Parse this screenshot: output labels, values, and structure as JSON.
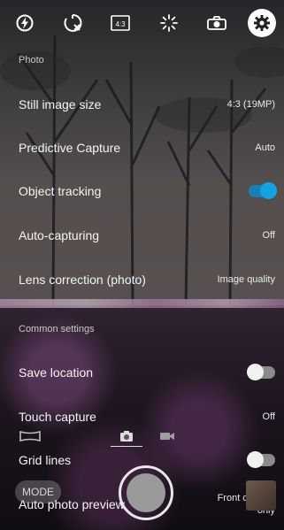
{
  "top_bar": {
    "icons": [
      "flash-auto-icon",
      "timer-off-icon",
      "aspect-ratio-icon",
      "brightness-icon",
      "self-timer-icon",
      "settings-gear-icon"
    ],
    "aspect_label": "4:3"
  },
  "settings": {
    "photo_section": "Photo",
    "still_image_size": {
      "label": "Still image size",
      "value": "4:3 (19MP)"
    },
    "predictive_capture": {
      "label": "Predictive Capture",
      "value": "Auto"
    },
    "object_tracking": {
      "label": "Object tracking",
      "on": true
    },
    "auto_capturing": {
      "label": "Auto-capturing",
      "value": "Off"
    },
    "lens_correction": {
      "label": "Lens correction (photo)",
      "value": "Image quality"
    },
    "common_section": "Common settings",
    "save_location": {
      "label": "Save location",
      "on": false
    },
    "touch_capture": {
      "label": "Touch capture",
      "value": "Off"
    },
    "grid_lines": {
      "label": "Grid lines",
      "on": false
    },
    "auto_photo_preview": {
      "label": "Auto photo preview",
      "value_line1": "Front camera",
      "value_line2": "only"
    }
  },
  "bottom": {
    "mode_label": "MODE",
    "mode_tabs": [
      "camera-icon",
      "video-camera-icon"
    ],
    "selected_tab": "camera-icon"
  },
  "colors": {
    "toggle_on": "#15a2e4",
    "toggle_off": "#8a8a8a"
  }
}
